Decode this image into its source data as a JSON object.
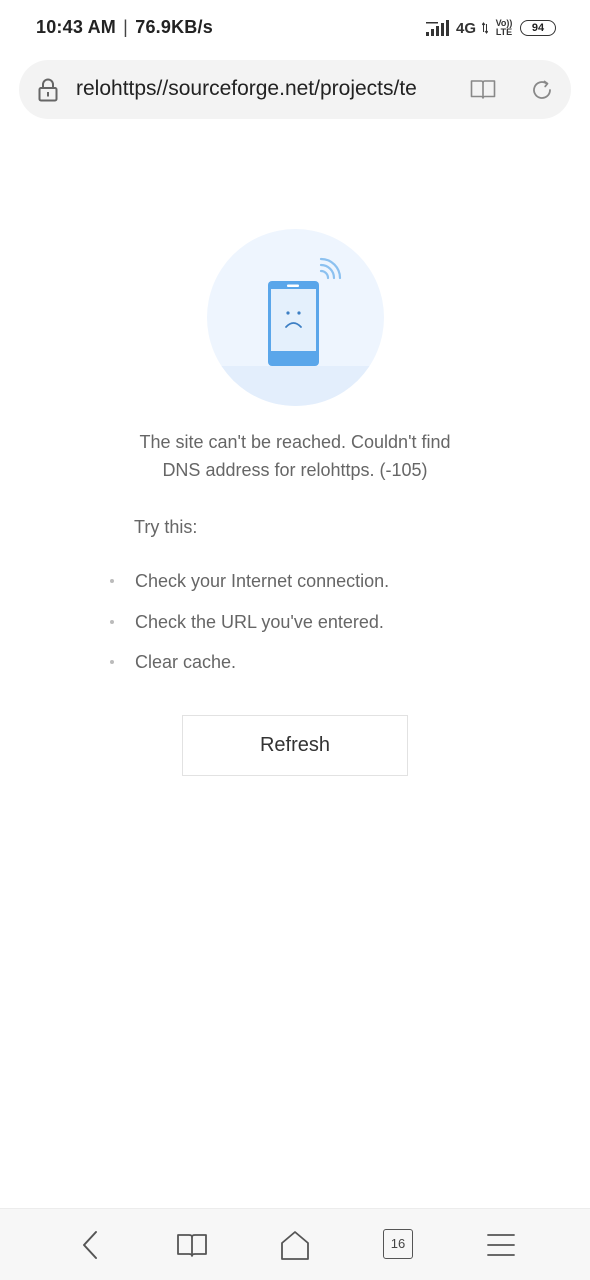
{
  "status_bar": {
    "time": "10:43 AM",
    "separator": "|",
    "speed": "76.9KB/s",
    "network_type": "4G",
    "volte_top": "Vo))",
    "volte_bottom": "LTE",
    "battery": "94"
  },
  "address_bar": {
    "url": "relohttps//sourceforge.net/projects/te"
  },
  "error": {
    "message_line1": "The site can't be reached. Couldn't find",
    "message_line2": "DNS address for relohttps. (-105)",
    "try_this": "Try this:",
    "suggestions": [
      "Check your Internet connection.",
      "Check the URL you've entered.",
      "Clear cache."
    ],
    "refresh_label": "Refresh"
  },
  "bottom_nav": {
    "tabs_count": "16"
  },
  "colors": {
    "illustration_circle": "#eaf3fd",
    "illustration_phone": "#5aa6ea",
    "text_muted": "#666666"
  }
}
